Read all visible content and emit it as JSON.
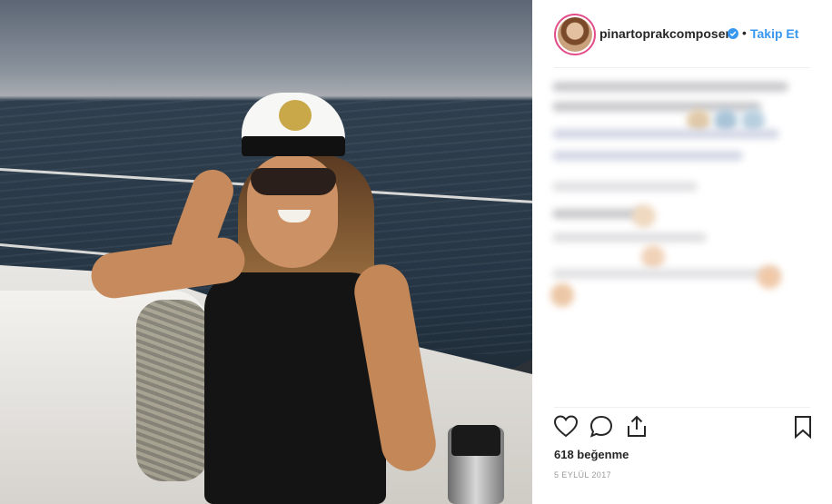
{
  "post": {
    "username": "pinartoprakcomposer",
    "separator": "•",
    "follow_label": "Takip Et",
    "likes_text": "618 beğenme",
    "date_text": "5 EYLÜL 2017"
  },
  "icons": {
    "like": "heart-icon",
    "comment": "comment-icon",
    "share": "share-icon",
    "save": "bookmark-icon",
    "verified": "verified-badge-icon"
  },
  "colors": {
    "link": "#3897f0",
    "verified": "#3897f0",
    "text": "#262626",
    "muted": "#999999",
    "story_ring": "#e34f8a"
  }
}
